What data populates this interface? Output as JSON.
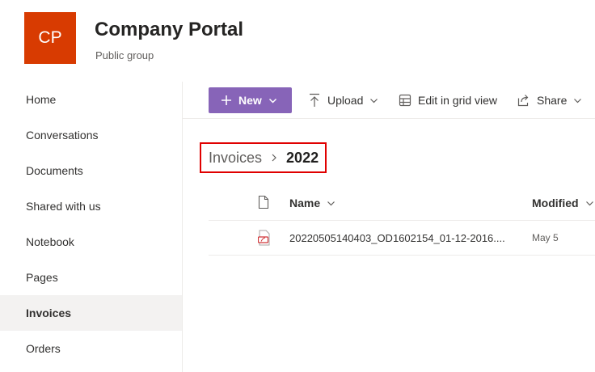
{
  "site": {
    "logo_initials": "CP",
    "title": "Company Portal",
    "subtitle": "Public group"
  },
  "nav": {
    "items": [
      {
        "label": "Home"
      },
      {
        "label": "Conversations"
      },
      {
        "label": "Documents"
      },
      {
        "label": "Shared with us"
      },
      {
        "label": "Notebook"
      },
      {
        "label": "Pages"
      },
      {
        "label": "Invoices",
        "selected": true
      },
      {
        "label": "Orders"
      }
    ]
  },
  "toolbar": {
    "new_label": "New",
    "upload_label": "Upload",
    "grid_label": "Edit in grid view",
    "share_label": "Share"
  },
  "breadcrumb": {
    "parent": "Invoices",
    "current": "2022"
  },
  "list": {
    "columns": {
      "name": "Name",
      "modified": "Modified"
    },
    "rows": [
      {
        "name": "20220505140403_OD1602154_01-12-2016....",
        "modified": "May 5"
      }
    ]
  },
  "colors": {
    "logo_bg": "#d83b01",
    "accent": "#8764b8",
    "highlight_border": "#e00000"
  },
  "icons": [
    "file-type-icon",
    "pdf-file-icon",
    "plus-icon",
    "upload-icon",
    "grid-icon",
    "share-icon",
    "chevron-down-icon",
    "breadcrumb-chevron-icon"
  ]
}
